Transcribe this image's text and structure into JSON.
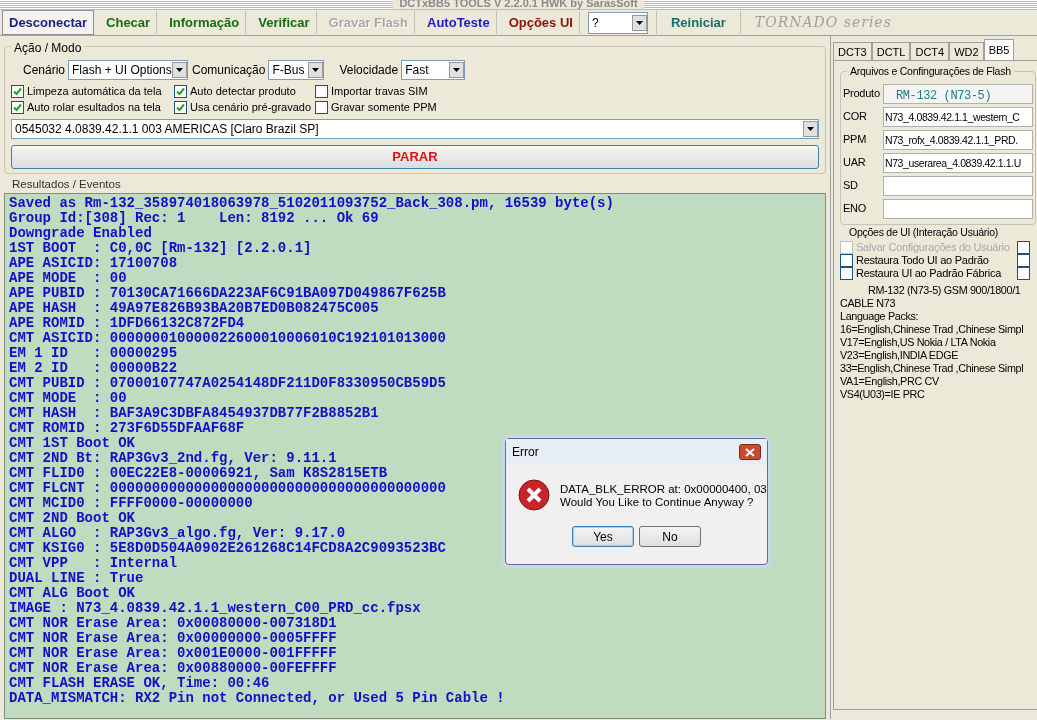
{
  "window": {
    "title": "DCTxBB5 TOOLS V 2.2.0.1 HWK by SarasSoft"
  },
  "toolbar": [
    {
      "label": "Desconectar",
      "color": "#1c1c8c",
      "selected": true,
      "disabled": false
    },
    {
      "label": "Checar",
      "color": "#107010",
      "selected": false,
      "disabled": false
    },
    {
      "label": "Informação",
      "color": "#107010",
      "selected": false,
      "disabled": false
    },
    {
      "label": "Verificar",
      "color": "#107010",
      "selected": false,
      "disabled": false
    },
    {
      "label": "Gravar Flash",
      "color": "#a8a8a8",
      "selected": false,
      "disabled": true
    },
    {
      "label": "AutoTeste",
      "color": "#1c1ccc",
      "selected": false,
      "disabled": false
    },
    {
      "label": "Opções UI",
      "color": "#8c1010",
      "selected": false,
      "disabled": false
    }
  ],
  "help_combo": {
    "value": "?"
  },
  "restart_button": {
    "label": "Reiniciar",
    "color": "#107070"
  },
  "logo": "TORNADO series",
  "action_mode": {
    "title": "Ação / Modo",
    "selects": [
      {
        "label": "Cenário",
        "value": "Flash + UI Options"
      },
      {
        "label": "Comunicação",
        "value": "F-Bus"
      },
      {
        "label": "Velocidade",
        "value": "Fast"
      }
    ],
    "checkboxes": [
      {
        "label": "Limpeza automática da tela",
        "checked": true
      },
      {
        "label": "Auto detectar produto",
        "checked": true
      },
      {
        "label": "Importar travas SIM",
        "checked": false
      },
      {
        "label": "Auto rolar esultados na tela",
        "checked": true
      },
      {
        "label": "Usa cenário pré-gravado",
        "checked": true
      },
      {
        "label": "Gravar somente PPM",
        "checked": false
      }
    ],
    "firmware_combo": {
      "value": "0545032 4.0839.42.1.1 003 AMERICAS [Claro Brazil SP]"
    },
    "stop_button": {
      "label": "PARAR"
    }
  },
  "results": {
    "title": "Resultados / Eventos",
    "lines": [
      "Saved as Rm-132_358974018063978_5102011093752_Back_308.pm, 16539 byte(s)",
      "Group Id:[308] Rec: 1    Len: 8192 ... Ok 69",
      "Downgrade Enabled",
      "1ST BOOT  : C0,0C [Rm-132] [2.2.0.1]",
      "APE ASICID: 17100708",
      "APE MODE  : 00",
      "APE PUBID : 70130CA71666DA223AF6C91BA097D049867F625B",
      "APE HASH  : 49A97E826B93BA20B7ED0B082475C005",
      "APE ROMID : 1DFD66132C872FD4",
      "CMT ASICID: 000000010000022600010006010C192101013000",
      "EM 1 ID   : 00000295",
      "EM 2 ID   : 00000B22",
      "CMT PUBID : 07000107747A0254148DF211D0F8330950CB59D5",
      "CMT MODE  : 00",
      "CMT HASH  : BAF3A9C3DBFA8454937DB77F2B8852B1",
      "CMT ROMID : 273F6D55DFAAF68F",
      "CMT 1ST Boot OK",
      "CMT 2ND Bt: RAP3Gv3_2nd.fg, Ver: 9.11.1",
      "CMT FLID0 : 00EC22E8-00006921, Sam K8S2815ETB",
      "CMT FLCNT : 0000000000000000000000000000000000000000",
      "CMT MCID0 : FFFF0000-00000000",
      "CMT 2ND Boot OK",
      "CMT ALGO  : RAP3Gv3_algo.fg, Ver: 9.17.0",
      "CMT KSIG0 : 5E8D0D504A0902E261268C14FCD8A2C9093523BC",
      "CMT VPP   : Internal",
      "DUAL LINE : True",
      "CMT ALG Boot OK",
      "IMAGE : N73_4.0839.42.1.1_western_C00_PRD_cc.fpsx",
      "CMT NOR Erase Area: 0x00080000-007318D1",
      "CMT NOR Erase Area: 0x00000000-0005FFFF",
      "CMT NOR Erase Area: 0x001E0000-001FFFFF",
      "CMT NOR Erase Area: 0x00880000-00FEFFFF",
      "CMT FLASH ERASE OK, Time: 00:46",
      "DATA_MISMATCH: RX2 Pin not Connected, or Used 5 Pin Cable !"
    ]
  },
  "side_tabs": [
    {
      "label": "DCT3",
      "selected": false
    },
    {
      "label": "DCTL",
      "selected": false
    },
    {
      "label": "DCT4",
      "selected": false
    },
    {
      "label": "WD2",
      "selected": false
    },
    {
      "label": "BB5",
      "selected": true
    }
  ],
  "flash_files": {
    "title": "Arquivos e Confingurações de Flash",
    "fields": [
      {
        "label": "Produto",
        "value": "RM-132  (N73-5)",
        "kind": "product"
      },
      {
        "label": "COR",
        "value": "N73_4.0839.42.1.1_western_C",
        "kind": "file"
      },
      {
        "label": "PPM",
        "value": "N73_rofx_4.0839.42.1.1_PRD.",
        "kind": "file"
      },
      {
        "label": "UAR",
        "value": "N73_userarea_4.0839.42.1.1.U",
        "kind": "file"
      },
      {
        "label": "SD",
        "kind": "file"
      },
      {
        "label": "ENO",
        "kind": "file"
      }
    ]
  },
  "ui_options": {
    "title": "Opções de UI (Interação Usuário)",
    "options": [
      {
        "label": "Salvar Configurações do Usuário",
        "checked": false,
        "disabled": true,
        "second_checked": false
      },
      {
        "label": "Restaura Todo UI ao Padrão",
        "checked": false,
        "disabled": false,
        "second_checked": false
      },
      {
        "label": "Restaura UI ao Padrão Fábrica",
        "checked": false,
        "disabled": false,
        "second_checked": false
      }
    ]
  },
  "product_info": {
    "heading": "RM-132 (N73-5) GSM 900/1800/1",
    "lines": [
      "CABLE N73",
      "Language Packs:",
      "16=English,Chinese Trad ,Chinese Simpl",
      "V17=English,US Nokia / LTA Nokia",
      "V23=English,INDIA EDGE",
      "33=English,Chinese Trad ,Chinese Simpl",
      "VA1=English,PRC CV",
      "VS4(U03)=IE PRC"
    ]
  },
  "dialog": {
    "title": "Error",
    "message_lines": [
      "DATA_BLK_ERROR at: 0x00000400, 03",
      "Would You Like to Continue Anyway ?"
    ],
    "buttons": [
      {
        "label": "Yes",
        "selected": true
      },
      {
        "label": "No",
        "selected": false
      }
    ]
  }
}
